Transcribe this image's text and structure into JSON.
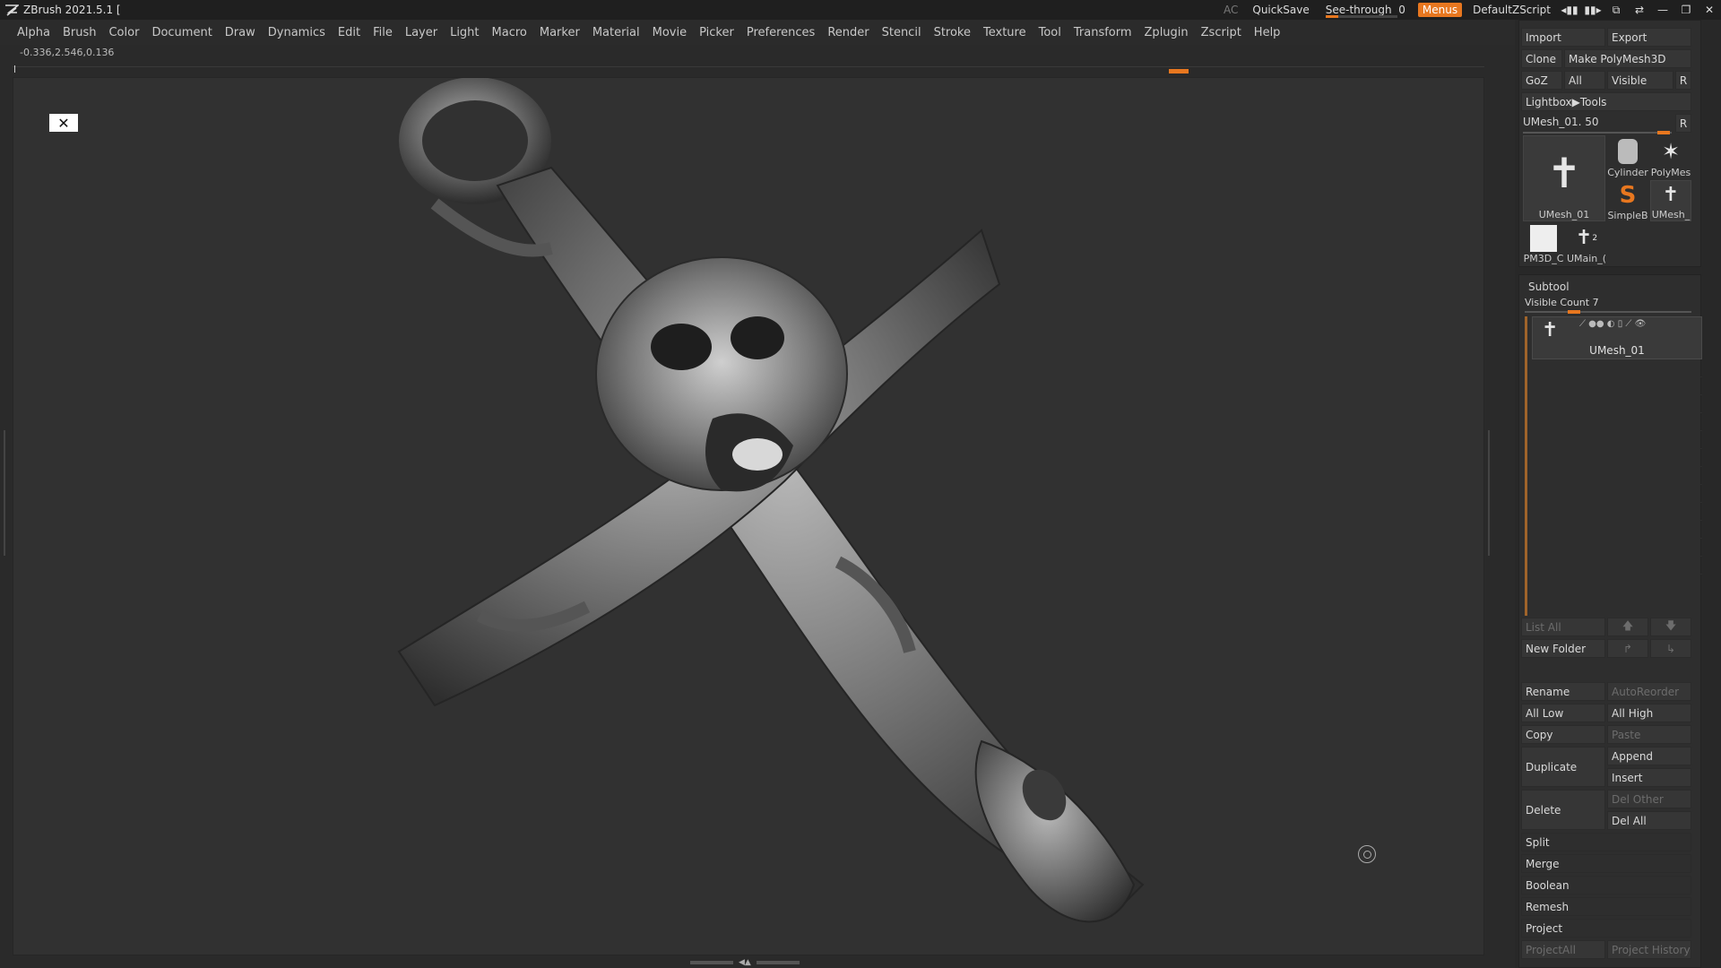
{
  "titlebar": {
    "app_title": "ZBrush 2021.5.1 [",
    "ac": "AC",
    "quicksave": "QuickSave",
    "seethrough_label": "See-through",
    "seethrough_value": "0",
    "seethrough_level": 0,
    "menus_label": "Menus",
    "script_label": "DefaultZScript"
  },
  "menubar": {
    "items": [
      "Alpha",
      "Brush",
      "Color",
      "Document",
      "Draw",
      "Dynamics",
      "Edit",
      "File",
      "Layer",
      "Light",
      "Macro",
      "Marker",
      "Material",
      "Movie",
      "Picker",
      "Preferences",
      "Render",
      "Stencil",
      "Stroke",
      "Texture",
      "Tool",
      "Transform",
      "Zplugin",
      "Zscript",
      "Help"
    ]
  },
  "viewport": {
    "coords": "-0.336,2.546,0.136"
  },
  "tool_panel": {
    "import": "Import",
    "export": "Export",
    "clone": "Clone",
    "make_polymesh": "Make PolyMesh3D",
    "goz": "GoZ",
    "all": "All",
    "visible": "Visible",
    "r": "R",
    "lightbox_tools": "Lightbox▶Tools",
    "current_tool": "UMesh_01. 50",
    "current_tool_slider": 0.92,
    "thumbs": {
      "umesh01": "UMesh_01",
      "cylinder": "Cylinder",
      "polymesh": "PolyMes",
      "simpleb": "SimpleB",
      "umesh_small": "UMesh_",
      "pm3d": "PM3D_C",
      "umain": "UMain_(",
      "umain_badge": "2"
    }
  },
  "subtool_panel": {
    "title": "Subtool",
    "visible_count": "Visible Count 7",
    "visible_count_slider": 0.29,
    "active_subtool": "UMesh_01",
    "list_all": "List All",
    "new_folder": "New Folder",
    "rename": "Rename",
    "autoreorder": "AutoReorder",
    "all_low": "All Low",
    "all_high": "All High",
    "copy": "Copy",
    "paste": "Paste",
    "duplicate": "Duplicate",
    "append": "Append",
    "insert": "Insert",
    "delete": "Delete",
    "del_other": "Del Other",
    "del_all": "Del All",
    "split": "Split",
    "merge": "Merge",
    "boolean": "Boolean",
    "remesh": "Remesh",
    "project": "Project",
    "project_all": "ProjectAll",
    "project_history": "Project History"
  },
  "colors": {
    "accent": "#e8771f",
    "panel_bg": "#282828",
    "viewport_bg": "#313131"
  }
}
